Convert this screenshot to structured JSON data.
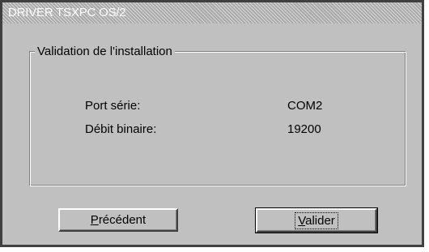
{
  "window": {
    "title": "DRIVER TSXPC OS/2"
  },
  "group": {
    "legend": "Validation de l'installation",
    "rows": [
      {
        "label": "Port série:",
        "value": "COM2"
      },
      {
        "label": "Débit binaire:",
        "value": "19200"
      }
    ]
  },
  "buttons": {
    "previous": {
      "mnemonic": "P",
      "rest": "récédent"
    },
    "validate": {
      "mnemonic": "V",
      "rest": "alider"
    }
  },
  "colors": {
    "face": "#c0c0c0",
    "frame": "#404040",
    "title_text": "#ffffff"
  }
}
